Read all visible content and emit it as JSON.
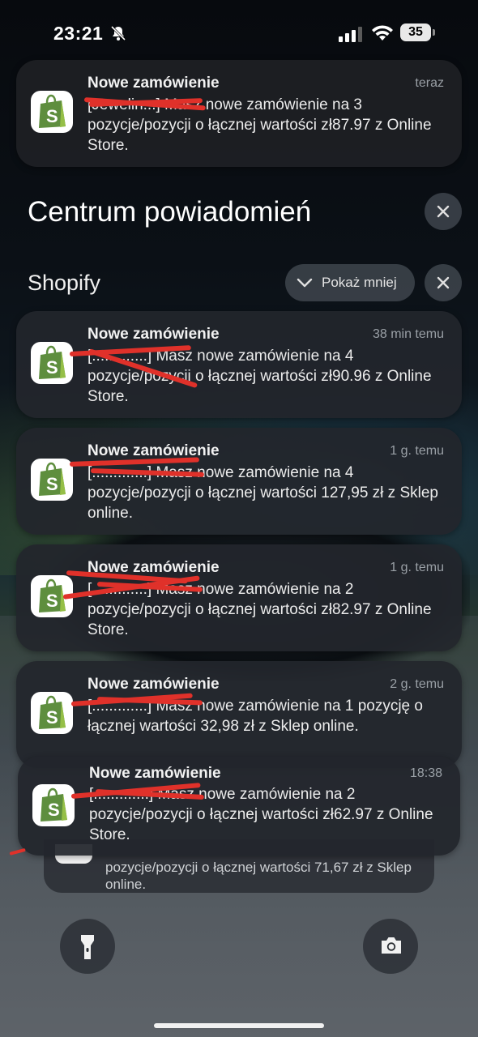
{
  "status_bar": {
    "time": "23:21",
    "battery": "35"
  },
  "banner": {
    "title": "Nowe zamówienie",
    "time": "teraz",
    "body": "[Jewelin...] Masz nowe zamówienie na 3 pozycje/pozycji o łącznej wartości zł87.97 z Online Store."
  },
  "center": {
    "title": "Centrum powiadomień"
  },
  "group": {
    "app_name": "Shopify",
    "show_less_label": "Pokaż mniej"
  },
  "notifications": [
    {
      "title": "Nowe zamówienie",
      "time": "38 min temu",
      "body": "[.............] Masz nowe zamówienie na 4 pozycje/pozycji o łącznej wartości zł90.96 z Online Store."
    },
    {
      "title": "Nowe zamówienie",
      "time": "1 g. temu",
      "body": "[.............] Masz nowe zamówienie na 4 pozycje/pozycji o łącznej wartości 127,95 zł z Sklep online."
    },
    {
      "title": "Nowe zamówienie",
      "time": "1 g. temu",
      "body": "[.............] Masz nowe zamówienie na 2 pozycje/pozycji o łącznej wartości zł82.97 z Online Store."
    },
    {
      "title": "Nowe zamówienie",
      "time": "2 g. temu",
      "body": "[.............] Masz nowe zamówienie na 1 pozycję o łącznej wartości 32,98 zł z Sklep online."
    },
    {
      "title": "Nowe zamówienie",
      "time": "18:38",
      "body": "[.............] Masz nowe zamówienie na 2 pozycje/pozycji o łącznej wartości zł62.97 z Online Store."
    }
  ],
  "stack_peek": {
    "body": "pozycje/pozycji o łącznej wartości 71,67 zł z Sklep online."
  },
  "colors": {
    "shopify_green": "#5e8e3e",
    "redaction": "#e0312a"
  },
  "icons": {
    "app": "shopify-bag-icon",
    "flashlight": "flashlight-icon",
    "camera": "camera-icon"
  }
}
